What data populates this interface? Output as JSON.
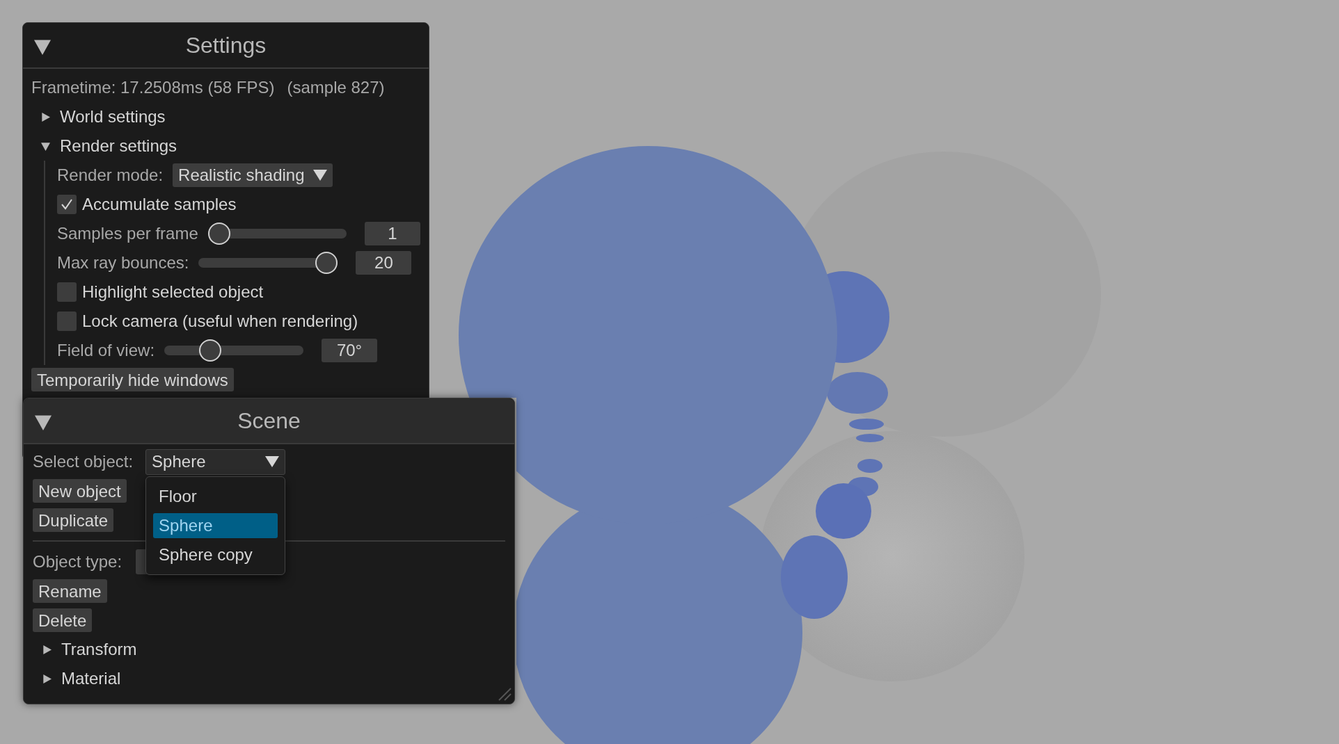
{
  "settings_window": {
    "title": "Settings",
    "expanded": true,
    "frametime": "Frametime: 17.2508ms (58 FPS)",
    "sample": "(sample 827)",
    "sections": [
      {
        "label": "World settings",
        "expanded": false
      },
      {
        "label": "Render settings",
        "expanded": true
      }
    ],
    "render_mode": {
      "label": "Render mode:",
      "value": "Realistic shading"
    },
    "rows": [
      {
        "kind": "checkbox",
        "label": "Accumulate samples",
        "checked": true
      },
      {
        "kind": "slider",
        "label": "Samples per frame",
        "level": 0,
        "value": "1"
      },
      {
        "kind": "slider",
        "label": "Max ray bounces:",
        "level": 1,
        "value": "20"
      },
      {
        "kind": "checkbox",
        "label": "Highlight selected object",
        "checked": false
      },
      {
        "kind": "checkbox",
        "label": "Lock camera (useful when rendering)",
        "checked": false
      },
      {
        "kind": "slider",
        "label": "Field of view:",
        "level": 0.3,
        "value": "70°"
      }
    ],
    "hide_button": "Temporarily hide windows"
  },
  "scene_window": {
    "title": "Scene",
    "expanded": true,
    "select_label": "Select object:",
    "select_value": "Sphere",
    "options": [
      {
        "label": "Floor",
        "selected": false
      },
      {
        "label": "Sphere",
        "selected": true
      },
      {
        "label": "Sphere copy",
        "selected": false
      }
    ],
    "buttons": [
      "New object",
      "Duplicate"
    ],
    "object_type_label": "Object type:",
    "object_buttons": [
      "Rename",
      "Delete"
    ],
    "sections": [
      {
        "label": "Transform",
        "expanded": false
      },
      {
        "label": "Material",
        "expanded": false
      }
    ]
  }
}
